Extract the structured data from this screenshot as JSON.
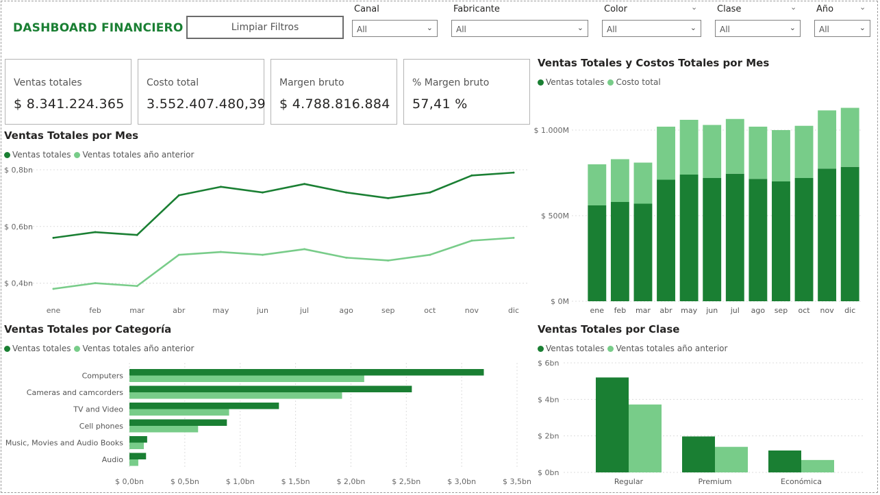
{
  "header": {
    "title": "DASHBOARD FINANCIERO",
    "clear_button": "Limpiar Filtros"
  },
  "slicers": [
    {
      "label": "Canal",
      "value": "All",
      "header_chevron": false
    },
    {
      "label": "Fabricante",
      "value": "All",
      "header_chevron": false
    },
    {
      "label": "Color",
      "value": "All",
      "header_chevron": true
    },
    {
      "label": "Clase",
      "value": "All",
      "header_chevron": true
    },
    {
      "label": "Año",
      "value": "All",
      "header_chevron": true
    }
  ],
  "kpis": [
    {
      "label": "Ventas totales",
      "value": "$ 8.341.224.365"
    },
    {
      "label": "Costo total",
      "value": "3.552.407.480,39"
    },
    {
      "label": "Margen bruto",
      "value": "$ 4.788.816.884"
    },
    {
      "label": "% Margen bruto",
      "value": "57,41 %"
    }
  ],
  "colors": {
    "dark_green": "#1a7f33",
    "light_green": "#78cc89",
    "title_green": "#1a7f33",
    "gridline": "#dcdcdc"
  },
  "chart_data": [
    {
      "id": "line-chart",
      "type": "line",
      "title": "Ventas Totales por Mes",
      "categories": [
        "ene",
        "feb",
        "mar",
        "abr",
        "may",
        "jun",
        "jul",
        "ago",
        "sep",
        "oct",
        "nov",
        "dic"
      ],
      "series": [
        {
          "name": "Ventas totales",
          "values": [
            0.56,
            0.58,
            0.57,
            0.71,
            0.74,
            0.72,
            0.75,
            0.72,
            0.7,
            0.72,
            0.78,
            0.79
          ]
        },
        {
          "name": "Ventas totales año anterior",
          "values": [
            0.38,
            0.4,
            0.39,
            0.5,
            0.51,
            0.5,
            0.52,
            0.49,
            0.48,
            0.5,
            0.55,
            0.56
          ]
        }
      ],
      "y_ticks": [
        "$ 0,8bn",
        "$ 0,6bn",
        "$ 0,4bn"
      ],
      "y_tick_values": [
        0.8,
        0.6,
        0.4
      ],
      "ylim": [
        0.3,
        0.8
      ],
      "grid": true,
      "legend": "top-left"
    },
    {
      "id": "stacked-chart",
      "type": "bar",
      "stacked": true,
      "title": "Ventas Totales y Costos Totales por Mes",
      "categories": [
        "ene",
        "feb",
        "mar",
        "abr",
        "may",
        "jun",
        "jul",
        "ago",
        "sep",
        "oct",
        "nov",
        "dic"
      ],
      "series": [
        {
          "name": "Ventas totales",
          "values": [
            560,
            580,
            570,
            710,
            740,
            720,
            745,
            715,
            700,
            720,
            775,
            785
          ]
        },
        {
          "name": "Costo total",
          "values": [
            240,
            250,
            240,
            310,
            320,
            310,
            320,
            305,
            300,
            305,
            340,
            345
          ]
        }
      ],
      "y_ticks": [
        "$ 1.000M",
        "$ 500M",
        "$ 0M"
      ],
      "y_tick_values": [
        1000,
        500,
        0
      ],
      "ylim": [
        0,
        1200
      ],
      "grid": true,
      "legend": "top-left"
    },
    {
      "id": "hbar-chart",
      "type": "bar",
      "orientation": "horizontal",
      "title": "Ventas Totales por Categoría",
      "categories": [
        "Computers",
        "Cameras and camcorders",
        "TV and Video",
        "Cell phones",
        "Music, Movies and Audio Books",
        "Audio"
      ],
      "series": [
        {
          "name": "Ventas totales",
          "values": [
            3.2,
            2.55,
            1.35,
            0.88,
            0.16,
            0.15
          ]
        },
        {
          "name": "Ventas totales año anterior",
          "values": [
            2.12,
            1.92,
            0.9,
            0.62,
            0.13,
            0.08
          ]
        }
      ],
      "x_ticks": [
        "$ 0,0bn",
        "$ 0,5bn",
        "$ 1,0bn",
        "$ 1,5bn",
        "$ 2,0bn",
        "$ 2,5bn",
        "$ 3,0bn",
        "$ 3,5bn"
      ],
      "x_tick_values": [
        0,
        0.5,
        1.0,
        1.5,
        2.0,
        2.5,
        3.0,
        3.5
      ],
      "xlim": [
        0,
        3.5
      ],
      "grid": true,
      "legend": "top-left"
    },
    {
      "id": "class-chart",
      "type": "bar",
      "title": "Ventas Totales por Clase",
      "categories": [
        "Regular",
        "Premium",
        "Económica"
      ],
      "series": [
        {
          "name": "Ventas totales",
          "values": [
            5.2,
            1.97,
            1.2
          ]
        },
        {
          "name": "Ventas totales año anterior",
          "values": [
            3.72,
            1.4,
            0.68
          ]
        }
      ],
      "y_ticks": [
        "$ 6bn",
        "$ 4bn",
        "$ 2bn",
        "$ 0bn"
      ],
      "y_tick_values": [
        6,
        4,
        2,
        0
      ],
      "ylim": [
        0,
        6
      ],
      "grid": true,
      "legend": "top-left"
    }
  ]
}
